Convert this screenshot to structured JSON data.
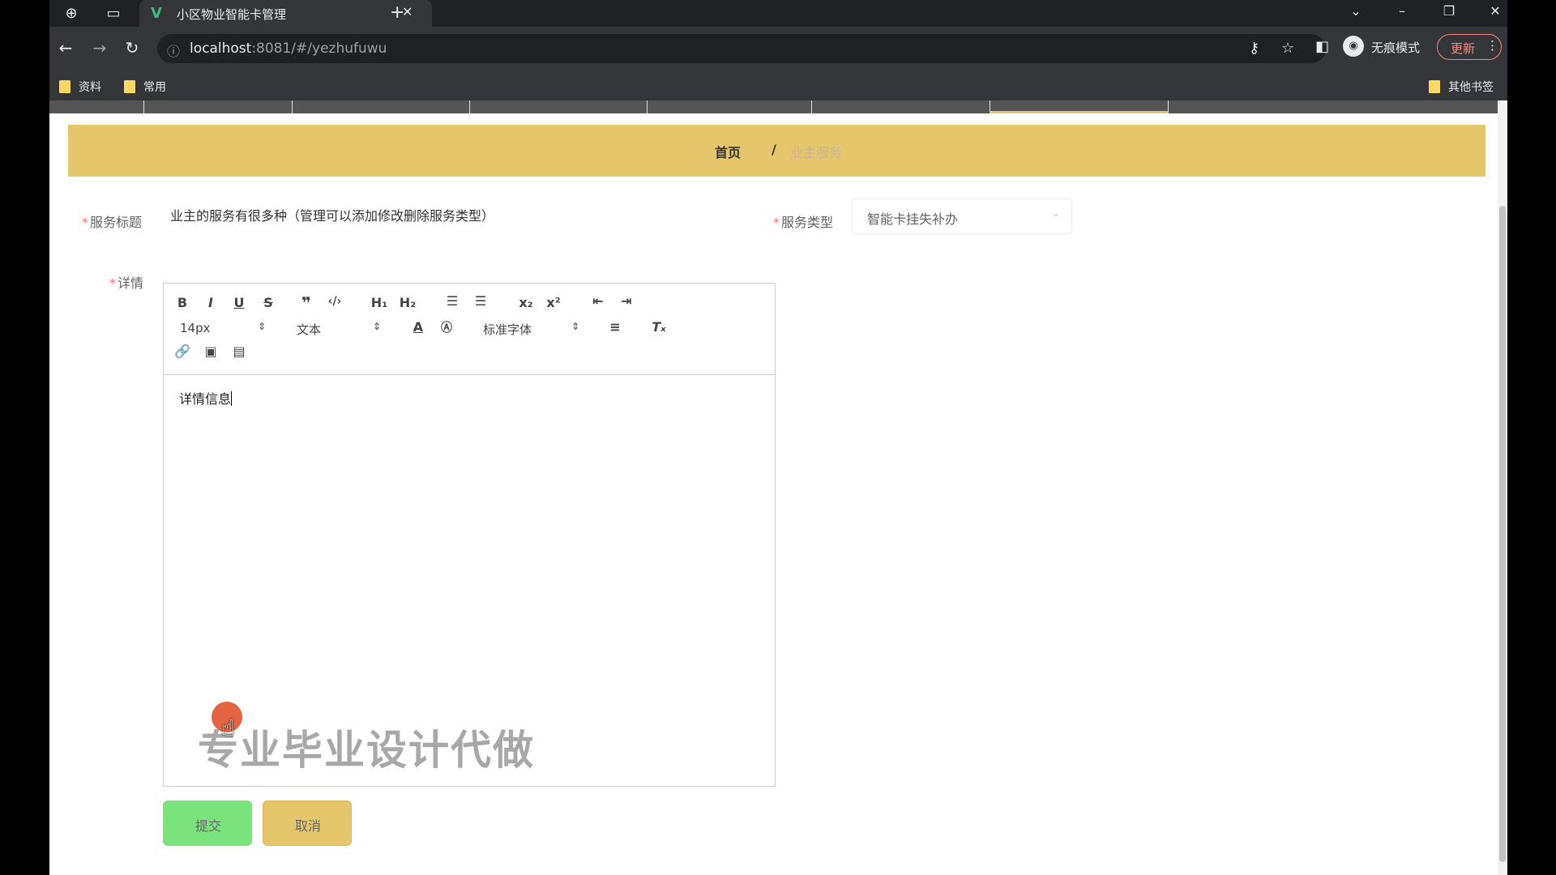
{
  "browser": {
    "tab_title": "小区物业智能卡管理",
    "tab_logo": "V",
    "url_host": "localhost",
    "url_rest": ":8081/#/yezhufuwu",
    "incognito_label": "无痕模式",
    "update_label": "更新",
    "bookmarks": [
      "资料",
      "常用"
    ],
    "other_bookmarks": "其他书签"
  },
  "breadcrumb": {
    "home": "首页",
    "separator": "/",
    "current": "业主服务"
  },
  "form": {
    "title_label": "服务标题",
    "title_value": "业主的服务有很多种（管理可以添加修改删除服务类型）",
    "type_label": "服务类型",
    "type_value": "智能卡挂失补办",
    "detail_label": "详情",
    "required_mark": "*"
  },
  "editor": {
    "font_size": "14px",
    "text_type": "文本",
    "font_family": "标准字体",
    "content": "详情信息",
    "watermark": "专业毕业设计代做"
  },
  "buttons": {
    "submit": "提交",
    "cancel": "取消"
  },
  "colors": {
    "accent": "#e6c66a",
    "submit": "#7be37b"
  }
}
